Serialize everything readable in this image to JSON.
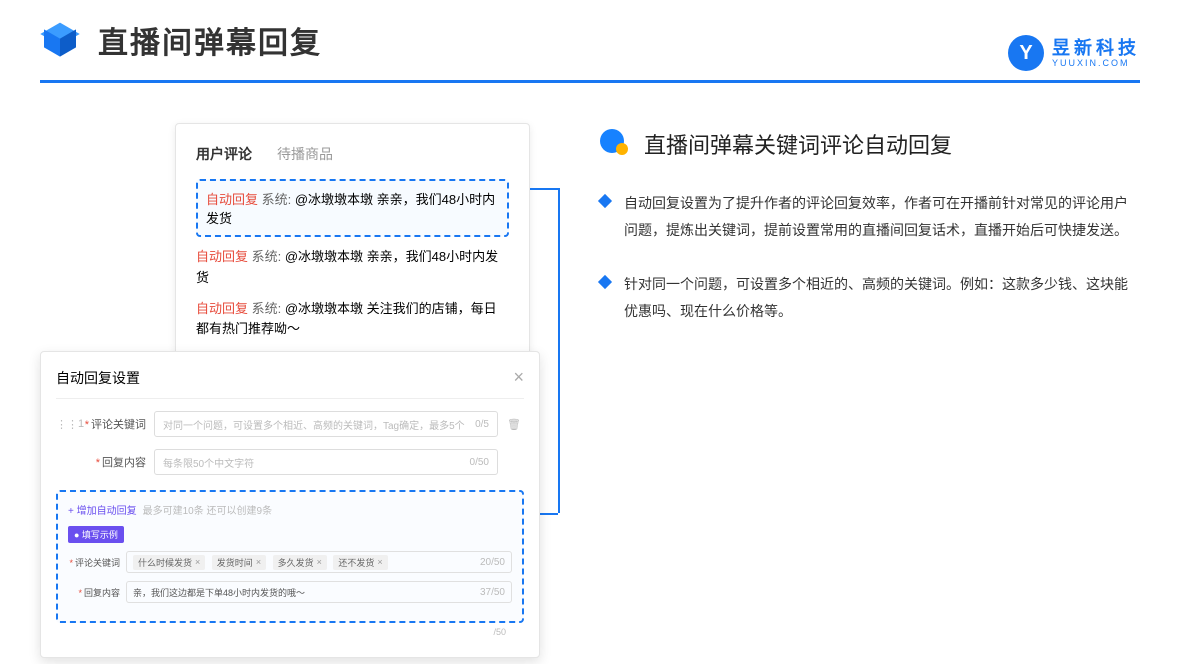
{
  "header": {
    "title": "直播间弹幕回复"
  },
  "brand": {
    "cn": "昱新科技",
    "en": "YUUXIN.COM",
    "glyph": "Y"
  },
  "comments": {
    "tabs": {
      "active": "用户评论",
      "inactive": "待播商品"
    },
    "row1_auto": "自动回复",
    "row1_sys": " 系统: ",
    "row1_text": "@冰墩墩本墩 亲亲，我们48小时内发货",
    "row2_auto": "自动回复",
    "row2_sys": " 系统: ",
    "row2_text": "@冰墩墩本墩 亲亲，我们48小时内发货",
    "row3_auto": "自动回复",
    "row3_sys": " 系统: ",
    "row3_text": "@冰墩墩本墩 关注我们的店铺，每日都有热门推荐呦～"
  },
  "settings": {
    "title": "自动回复设置",
    "idx": "1",
    "kw_label": "评论关键词",
    "kw_placeholder": "对同一个问题，可设置多个相近、高频的关键词，Tag确定，最多5个",
    "kw_counter": "0/5",
    "content_label": "回复内容",
    "content_placeholder": "每条限50个中文字符",
    "content_counter": "0/50",
    "add_link": "+ 增加自动回复",
    "add_hint": "最多可建10条 还可以创建9条",
    "example_badge": "● 填写示例",
    "ex_kw_label": "评论关键词",
    "ex_tag1": "什么时候发货",
    "ex_tag2": "发货时间",
    "ex_tag3": "多久发货",
    "ex_tag4": "还不发货",
    "ex_kw_counter": "20/50",
    "ex_content_label": "回复内容",
    "ex_content_text": "亲，我们这边都是下单48小时内发货的哦～",
    "ex_content_counter": "37/50",
    "foot_counter": "/50"
  },
  "right": {
    "section_title": "直播间弹幕关键词评论自动回复",
    "bullet1": "自动回复设置为了提升作者的评论回复效率，作者可在开播前针对常见的评论用户问题，提炼出关键词，提前设置常用的直播间回复话术，直播开始后可快捷发送。",
    "bullet2": "针对同一个问题，可设置多个相近的、高频的关键词。例如：这款多少钱、这块能优惠吗、现在什么价格等。"
  }
}
